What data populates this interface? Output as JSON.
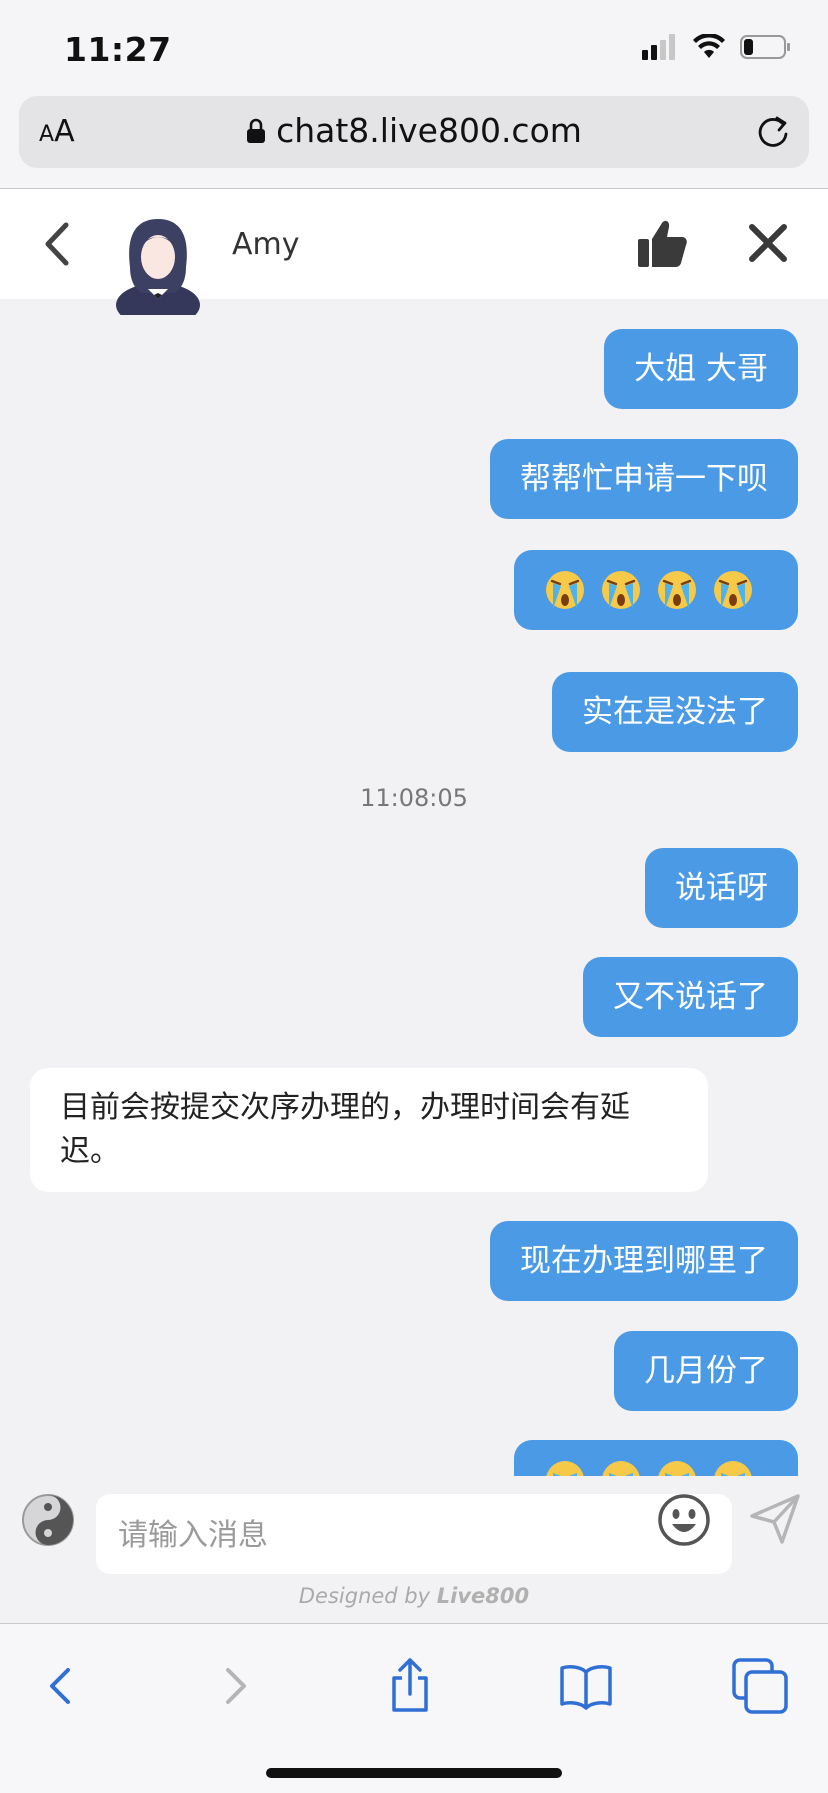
{
  "status_bar": {
    "time": "11:27"
  },
  "browser": {
    "aa_label_small": "A",
    "aa_label_large": "A",
    "url": "chat8.live800.com"
  },
  "chat_header": {
    "agent_name": "Amy"
  },
  "messages": [
    {
      "from": "user",
      "text": "大姐 大哥"
    },
    {
      "from": "user",
      "text": "帮帮忙申请一下呗"
    },
    {
      "from": "user",
      "emoji": [
        "crying-face-icon",
        "crying-face-icon",
        "crying-face-icon",
        "crying-face-icon"
      ]
    },
    {
      "from": "user",
      "text": "实在是没法了"
    },
    {
      "timestamp": "11:08:05"
    },
    {
      "from": "user",
      "text": "说话呀"
    },
    {
      "from": "user",
      "text": "又不说话了"
    },
    {
      "from": "agent",
      "text": "目前会按提交次序办理的，办理时间会有延迟。"
    },
    {
      "from": "user",
      "text": "现在办理到哪里了"
    },
    {
      "from": "user",
      "text": "几月份了"
    },
    {
      "from": "user",
      "emoji": [
        "crying-face-icon",
        "crying-face-icon",
        "crying-face-icon",
        "crying-face-icon"
      ]
    }
  ],
  "input": {
    "placeholder": "请输入消息"
  },
  "credit": {
    "prefix": "Designed by ",
    "brand": "Live800"
  },
  "colors": {
    "bubble_out": "#4b9ae6",
    "bubble_in": "#ffffff",
    "chat_bg": "#f2f2f4",
    "toolbar_icon": "#2f6fd6"
  }
}
